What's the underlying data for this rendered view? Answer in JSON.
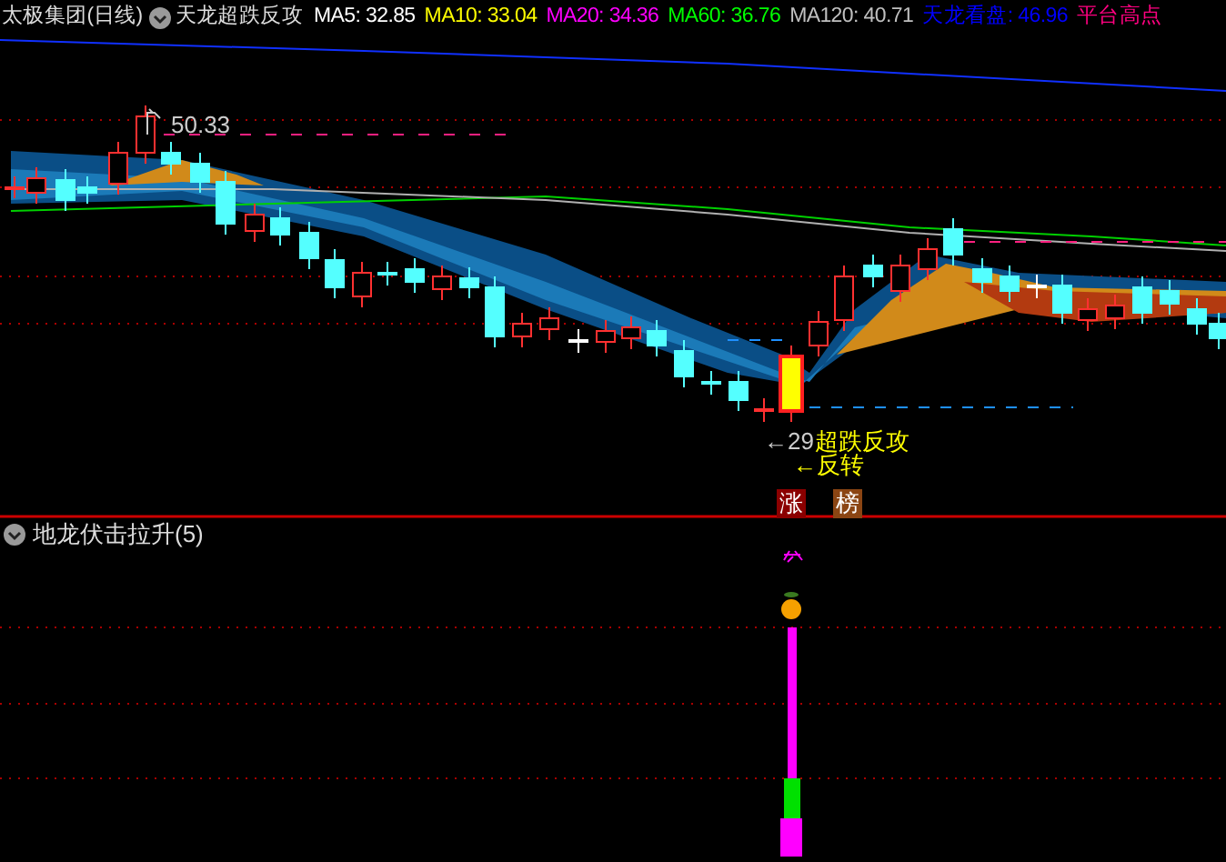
{
  "main_panel": {
    "stock_name": "太极集团(日线)",
    "indicator_name": "天龙超跌反攻",
    "readings": [
      {
        "label": "MA5: 32.85",
        "color": "#ffffff"
      },
      {
        "label": "MA10: 33.04",
        "color": "#ffff00"
      },
      {
        "label": "MA20: 34.36",
        "color": "#ff00ff"
      },
      {
        "label": "MA60: 36.76",
        "color": "#00ff00"
      },
      {
        "label": "MA120: 40.71",
        "color": "#c0c0c0"
      },
      {
        "label": "天龙看盘: 46.96",
        "color": "#0000ff"
      },
      {
        "label": "平台高点",
        "color": "#ff0080"
      }
    ],
    "high_price_label": "50.33",
    "low_price_label": "←29",
    "signal_label": "超跌反攻",
    "reversal_label": "←反转",
    "badges": [
      {
        "text": "涨",
        "color": "#8b0000"
      },
      {
        "text": "榜",
        "color": "#8b4513"
      }
    ]
  },
  "sub_panel": {
    "indicator_name": "地龙伏击拉升(5)"
  }
}
